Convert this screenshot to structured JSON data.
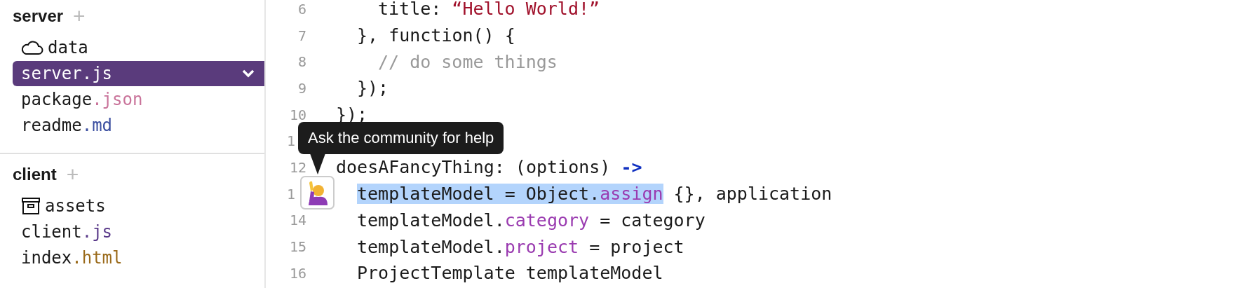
{
  "sidebar": {
    "sections": [
      {
        "title": "server",
        "add": "+",
        "items": [
          {
            "kind": "cloud",
            "name": "data",
            "selected": false
          },
          {
            "kind": "file",
            "name": "server",
            "ext": ".js",
            "selected": true
          },
          {
            "kind": "file",
            "name": "package",
            "ext": ".json",
            "color": "#c9739a",
            "selected": false
          },
          {
            "kind": "file",
            "name": "readme",
            "ext": ".md",
            "color": "#3b4fa0",
            "selected": false
          }
        ]
      },
      {
        "title": "client",
        "add": "+",
        "items": [
          {
            "kind": "archive",
            "name": "assets",
            "selected": false
          },
          {
            "kind": "file",
            "name": "client",
            "ext": ".js",
            "color": "#5a3a8a",
            "selected": false
          },
          {
            "kind": "file",
            "name": "index",
            "ext": ".html",
            "color": "#9a6a1a",
            "selected": false
          }
        ]
      }
    ]
  },
  "editor": {
    "lines": [
      {
        "number": "6",
        "covered": false,
        "kind": "innermost",
        "tokens": [
          {
            "kind": "plain",
            "text": "title: "
          },
          {
            "kind": "string",
            "text": "“Hello World!”"
          }
        ]
      },
      {
        "number": "7",
        "covered": false,
        "kind": "inner",
        "tokens": [
          {
            "kind": "plain",
            "text": "}, function() {"
          }
        ]
      },
      {
        "number": "8",
        "covered": false,
        "kind": "innermost",
        "tokens": [
          {
            "kind": "comment",
            "text": "// do some things"
          }
        ]
      },
      {
        "number": "9",
        "covered": false,
        "kind": "inner",
        "tokens": [
          {
            "kind": "plain",
            "text": "});"
          }
        ]
      },
      {
        "number": "10",
        "covered": false,
        "kind": "top",
        "tokens": [
          {
            "kind": "plain",
            "text": "});"
          }
        ]
      },
      {
        "number": "1",
        "covered": true
      },
      {
        "number": "12",
        "covered": false,
        "kind": "top",
        "tokens": [
          {
            "kind": "plain",
            "text": "doesAFancyThing: (options) "
          },
          {
            "kind": "arrow",
            "text": "->"
          }
        ]
      },
      {
        "number": "1",
        "covered": true,
        "kind": "inner",
        "tokens": [
          {
            "kind": "plain",
            "text": "templateModel = Object.",
            "selected": true
          },
          {
            "kind": "property",
            "text": "assign",
            "selected": true
          },
          {
            "kind": "plain",
            "text": " {}, application",
            "selected": false
          }
        ]
      },
      {
        "number": "14",
        "covered": false,
        "kind": "inner",
        "tokens": [
          {
            "kind": "plain",
            "text": "templateModel."
          },
          {
            "kind": "property",
            "text": "category"
          },
          {
            "kind": "plain",
            "text": " = category"
          }
        ]
      },
      {
        "number": "15",
        "covered": false,
        "kind": "inner",
        "tokens": [
          {
            "kind": "plain",
            "text": "templateModel."
          },
          {
            "kind": "property",
            "text": "project"
          },
          {
            "kind": "plain",
            "text": " = project"
          }
        ]
      },
      {
        "number": "16",
        "covered": false,
        "kind": "inner",
        "tokens": [
          {
            "kind": "plain",
            "text": "ProjectTemplate templateModel"
          }
        ]
      }
    ],
    "tooltip": "Ask the community for help"
  }
}
